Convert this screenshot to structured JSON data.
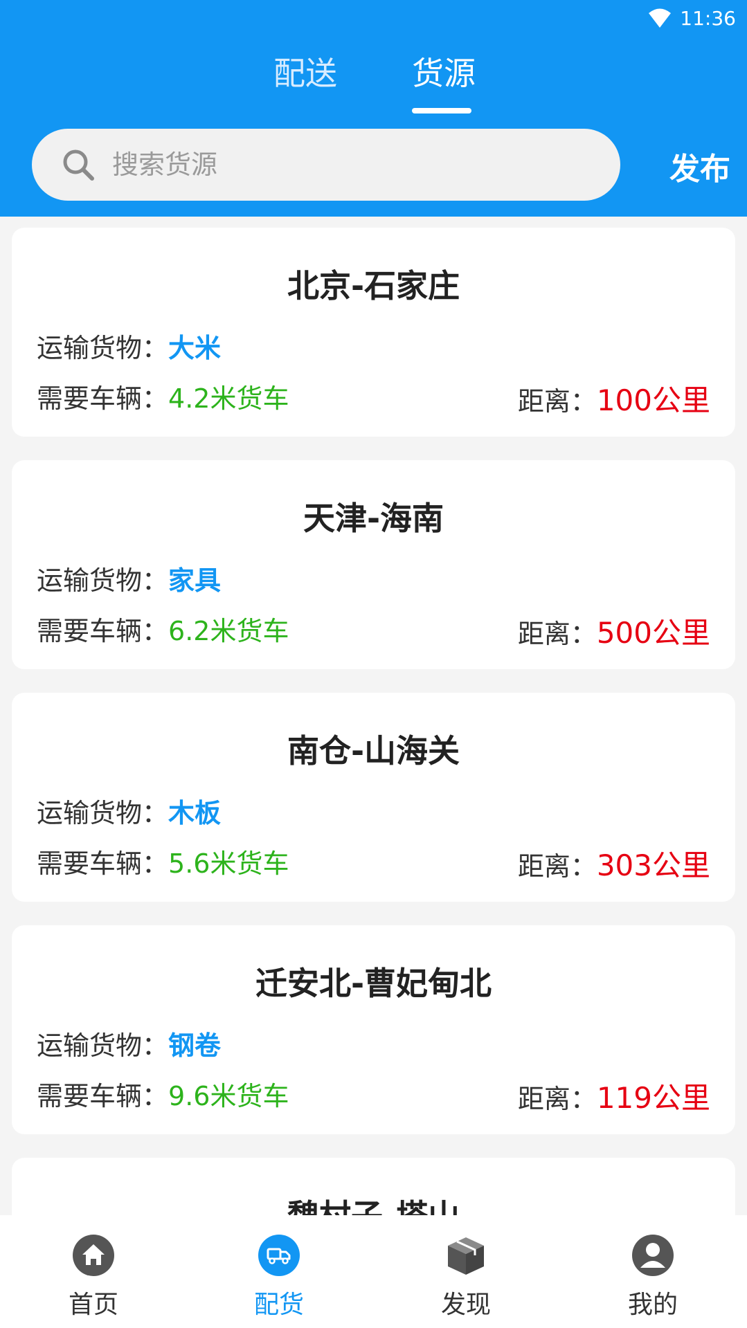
{
  "status_bar": {
    "time": "11:36",
    "icons": [
      "wifi-icon"
    ]
  },
  "header": {
    "tabs": [
      {
        "label": "配送",
        "active": false
      },
      {
        "label": "货源",
        "active": true
      }
    ],
    "search": {
      "placeholder": "搜索货源",
      "value": ""
    },
    "publish_label": "发布"
  },
  "labels": {
    "cargo": "运输货物：",
    "vehicle": "需要车辆：",
    "distance": "距离："
  },
  "cards": [
    {
      "route": "北京-石家庄",
      "cargo": "大米",
      "vehicle": "4.2米货车",
      "distance": "100公里"
    },
    {
      "route": "天津-海南",
      "cargo": "家具",
      "vehicle": "6.2米货车",
      "distance": "500公里"
    },
    {
      "route": "南仓-山海关",
      "cargo": "木板",
      "vehicle": "5.6米货车",
      "distance": "303公里"
    },
    {
      "route": "迁安北-曹妃甸北",
      "cargo": "钢卷",
      "vehicle": "9.6米货车",
      "distance": "119公里"
    },
    {
      "route": "魏村子-塔山",
      "cargo": "",
      "vehicle": "",
      "distance": ""
    }
  ],
  "bottom_nav": [
    {
      "label": "首页",
      "icon": "home-icon",
      "active": false
    },
    {
      "label": "配货",
      "icon": "truck-icon",
      "active": true
    },
    {
      "label": "发现",
      "icon": "box-icon",
      "active": false
    },
    {
      "label": "我的",
      "icon": "user-icon",
      "active": false
    }
  ],
  "colors": {
    "primary": "#1296f3",
    "cargo": "#1296f3",
    "vehicle": "#2db31c",
    "distance": "#e60012",
    "nav_icon": "#555555"
  }
}
